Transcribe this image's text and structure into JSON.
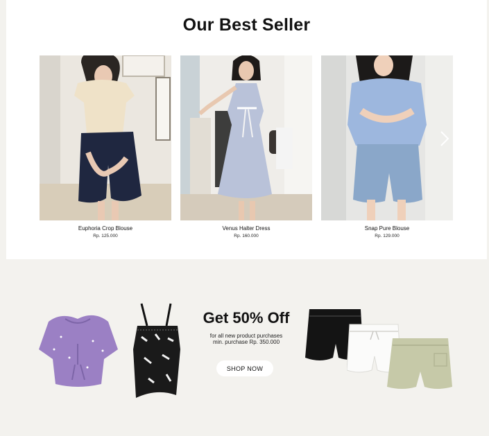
{
  "best_seller": {
    "title": "Our Best Seller",
    "products": [
      {
        "name": "Euphoria Crop Blouse",
        "price": "Rp. 125.000"
      },
      {
        "name": "Venus Halter Dress",
        "price": "Rp. 160.000"
      },
      {
        "name": "Snap Pure Blouse",
        "price": "Rp. 129.000"
      }
    ]
  },
  "promo": {
    "title": "Get 50% Off",
    "subtitle_line1": "for all new product purchases",
    "subtitle_line2": "min. purchase Rp. 350.000",
    "cta_label": "SHOP NOW"
  },
  "colors": {
    "page_bg": "#f3f2ee",
    "card_bg": "#ffffff",
    "text": "#111111"
  },
  "icons": {
    "carousel_next": "chevron-right-icon"
  }
}
